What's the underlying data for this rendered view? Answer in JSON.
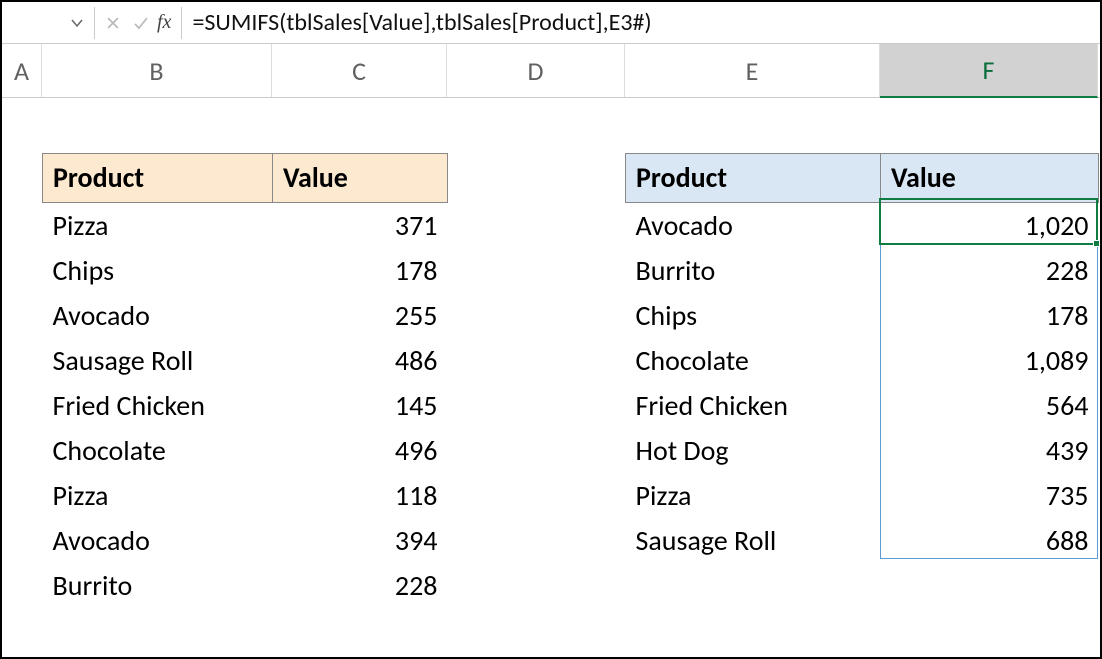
{
  "formula_bar": {
    "formula": "=SUMIFS(tblSales[Value],tblSales[Product],E3#)",
    "fx_label": "fx"
  },
  "columns": {
    "A": "A",
    "B": "B",
    "C": "C",
    "D": "D",
    "E": "E",
    "F": "F"
  },
  "left_table": {
    "headers": {
      "product": "Product",
      "value": "Value"
    },
    "rows": [
      {
        "product": "Pizza",
        "value": "371"
      },
      {
        "product": "Chips",
        "value": "178"
      },
      {
        "product": "Avocado",
        "value": "255"
      },
      {
        "product": "Sausage Roll",
        "value": "486"
      },
      {
        "product": "Fried Chicken",
        "value": "145"
      },
      {
        "product": "Chocolate",
        "value": "496"
      },
      {
        "product": "Pizza",
        "value": "118"
      },
      {
        "product": "Avocado",
        "value": "394"
      },
      {
        "product": "Burrito",
        "value": "228"
      }
    ]
  },
  "right_table": {
    "headers": {
      "product": "Product",
      "value": "Value"
    },
    "rows": [
      {
        "product": "Avocado",
        "value": "1,020"
      },
      {
        "product": "Burrito",
        "value": "228"
      },
      {
        "product": "Chips",
        "value": "178"
      },
      {
        "product": "Chocolate",
        "value": "1,089"
      },
      {
        "product": "Fried Chicken",
        "value": "564"
      },
      {
        "product": "Hot Dog",
        "value": "439"
      },
      {
        "product": "Pizza",
        "value": "735"
      },
      {
        "product": "Sausage Roll",
        "value": "688"
      }
    ]
  }
}
